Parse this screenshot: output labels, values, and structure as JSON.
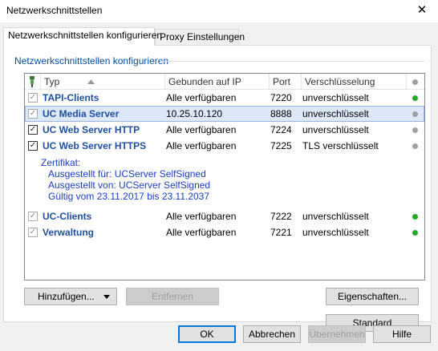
{
  "window": {
    "title": "Netzwerkschnittstellen",
    "close_glyph": "✕"
  },
  "tabs": [
    {
      "label": "Netzwerkschnittstellen konfigurieren",
      "active": true
    },
    {
      "label": "Proxy Einstellungen",
      "active": false
    }
  ],
  "group": {
    "title": "Netzwerkschnittstellen konfigurieren"
  },
  "table": {
    "headers": {
      "type": "Typ",
      "ip": "Gebunden auf IP",
      "port": "Port",
      "enc": "Verschlüsselung"
    },
    "rows": [
      {
        "name": "TAPI-Clients",
        "ip": "Alle verfügbaren",
        "port": "7220",
        "enc": "unverschlüsselt",
        "checked": true,
        "check_enabled": false,
        "status_color": "#22aa22",
        "selected": false
      },
      {
        "name": "UC Media Server",
        "ip": "10.25.10.120",
        "port": "8888",
        "enc": "unverschlüsselt",
        "checked": true,
        "check_enabled": false,
        "status_color": "#a0a0a0",
        "selected": true
      },
      {
        "name": "UC Web Server HTTP",
        "ip": "Alle verfügbaren",
        "port": "7224",
        "enc": "unverschlüsselt",
        "checked": true,
        "check_enabled": true,
        "status_color": "#a0a0a0",
        "selected": false
      },
      {
        "name": "UC Web Server HTTPS",
        "ip": "Alle verfügbaren",
        "port": "7225",
        "enc": "TLS verschlüsselt",
        "checked": true,
        "check_enabled": true,
        "status_color": "#a0a0a0",
        "selected": false
      },
      {
        "name": "UC-Clients",
        "ip": "Alle verfügbaren",
        "port": "7222",
        "enc": "unverschlüsselt",
        "checked": true,
        "check_enabled": false,
        "status_color": "#22aa22",
        "selected": false
      },
      {
        "name": "Verwaltung",
        "ip": "Alle verfügbaren",
        "port": "7221",
        "enc": "unverschlüsselt",
        "checked": true,
        "check_enabled": false,
        "status_color": "#22aa22",
        "selected": false
      }
    ],
    "certificate": {
      "heading": "Zertifikat:",
      "issued_to": "Ausgestellt für: UCServer SelfSigned",
      "issued_by": "Ausgestellt von: UCServer SelfSigned",
      "validity": "Gültig vom 23.11.2017 bis 23.11.2037"
    }
  },
  "buttons": {
    "add": "Hinzufügen...",
    "remove": "Entfernen",
    "properties": "Eigenschaften...",
    "standard": "Standard",
    "ok": "OK",
    "cancel": "Abbrechen",
    "apply": "Übernehmen",
    "help": "Hilfe"
  }
}
